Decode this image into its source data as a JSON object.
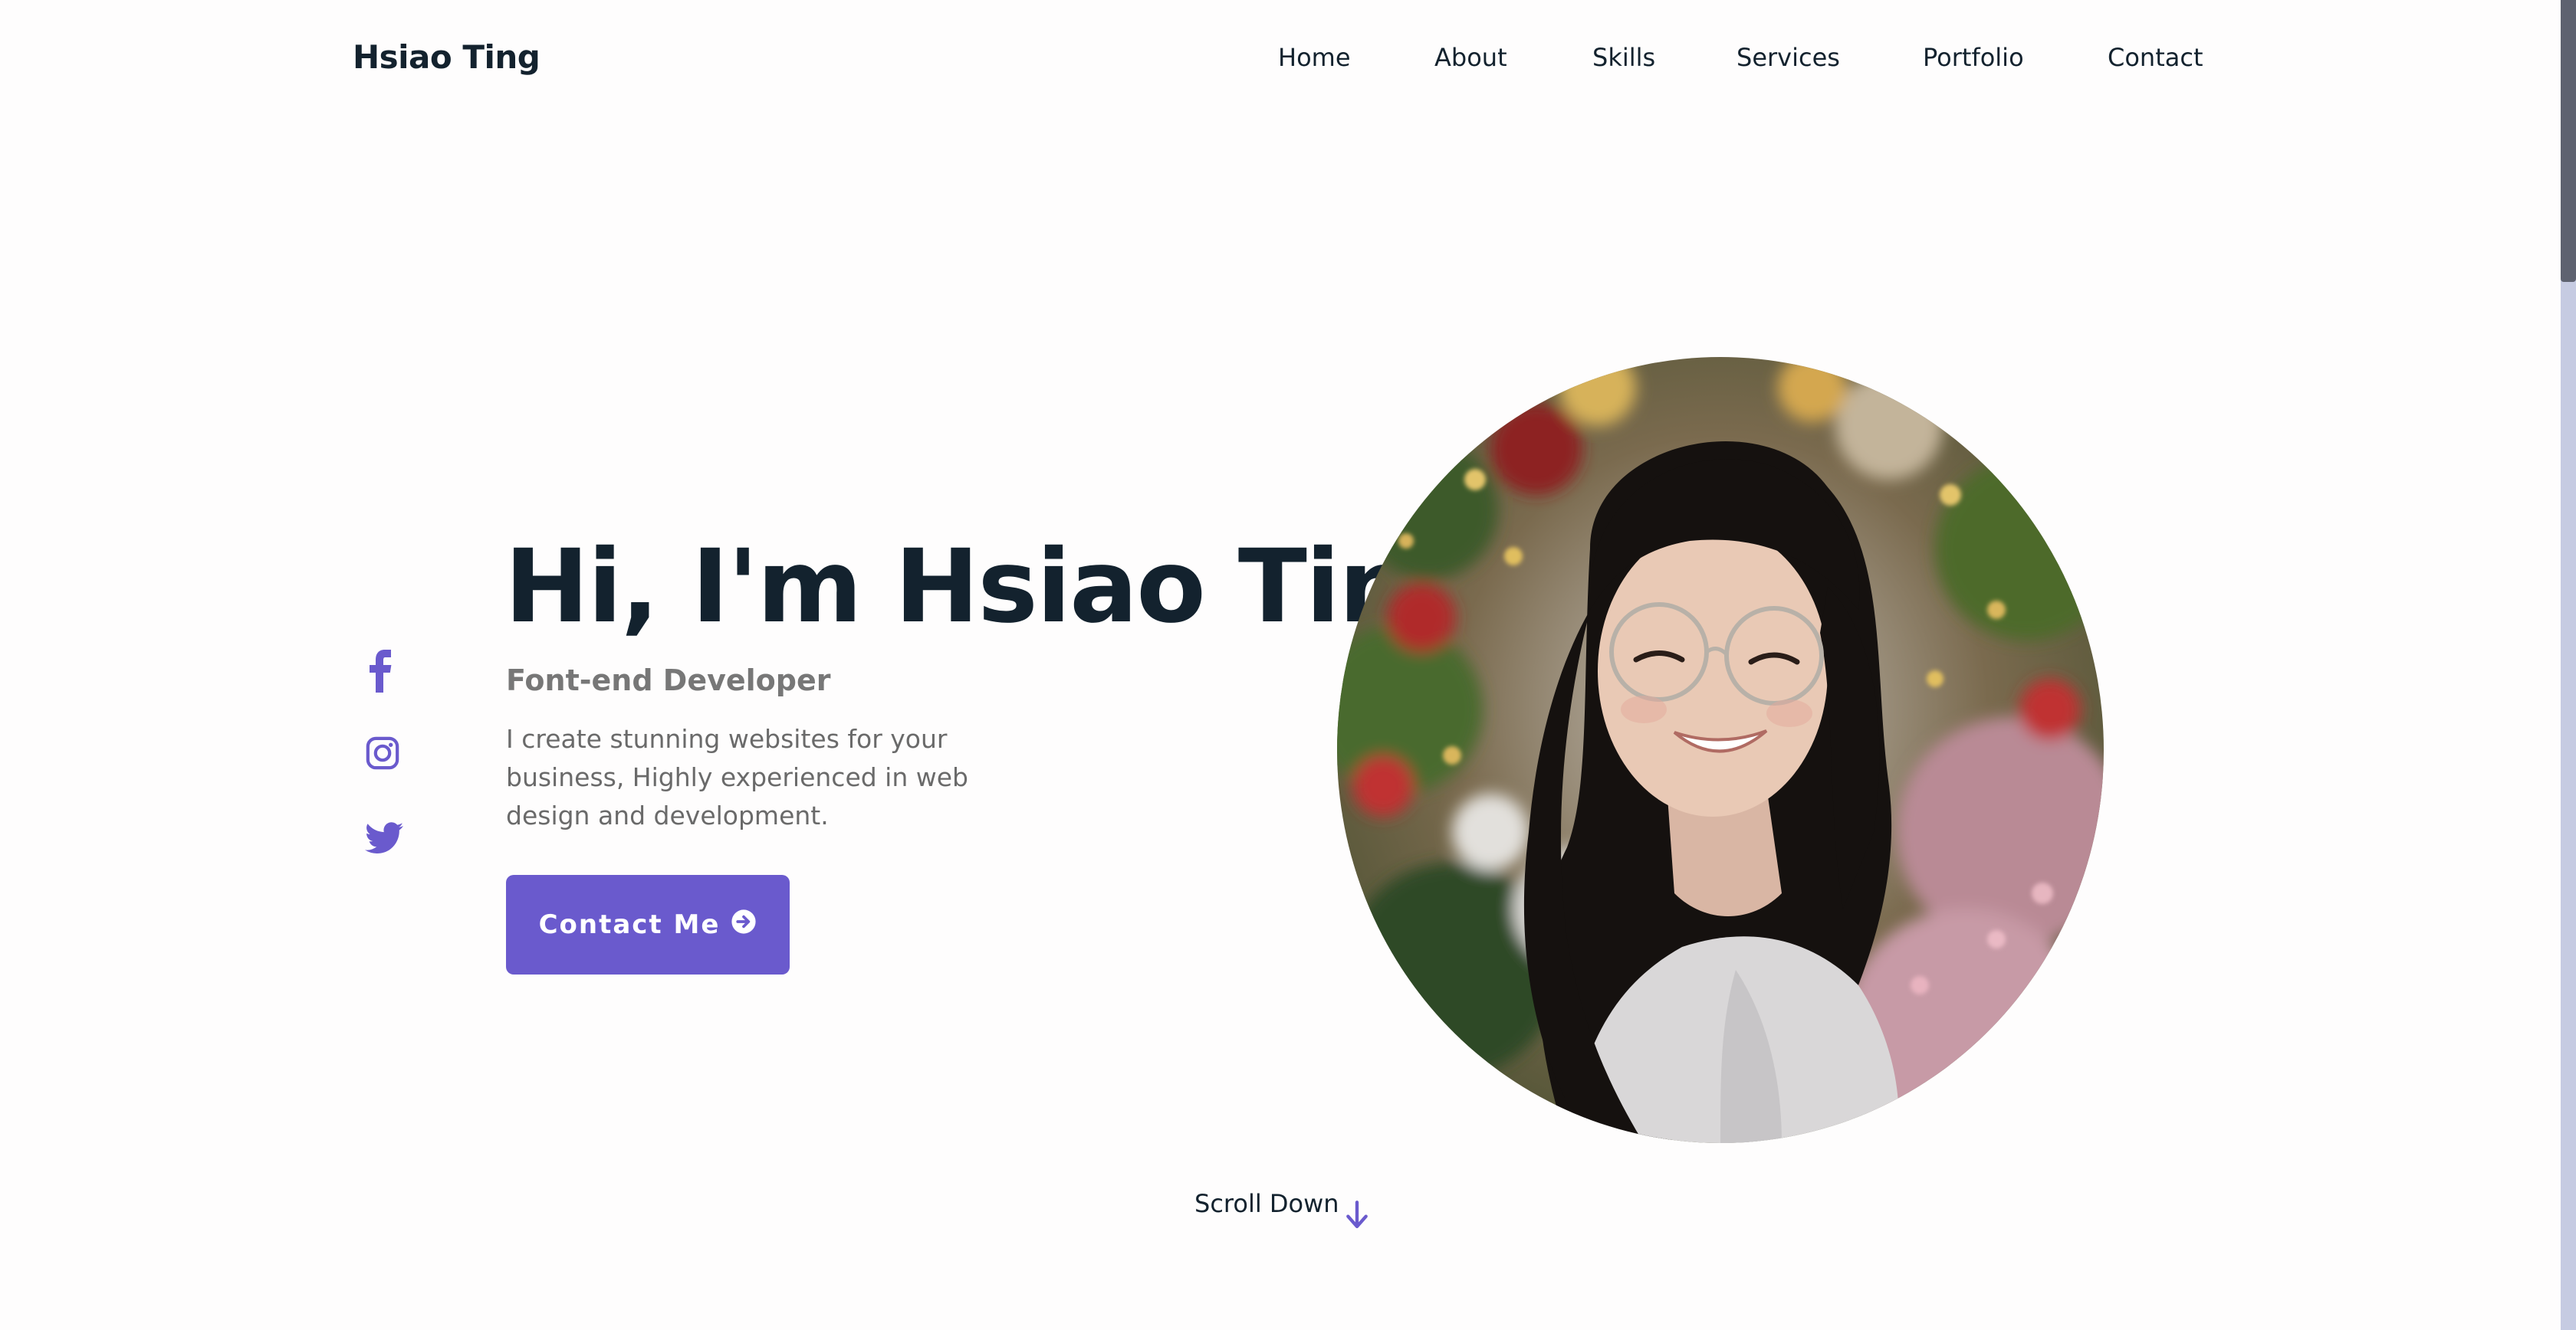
{
  "header": {
    "logo": "Hsiao Ting",
    "nav": [
      "Home",
      "About",
      "Skills",
      "Services",
      "Portfolio",
      "Contact"
    ]
  },
  "social": {
    "icons": [
      "facebook-icon",
      "instagram-icon",
      "twitter-icon"
    ]
  },
  "hero": {
    "title": "Hi, I'm Hsiao Ting",
    "subtitle": "Font-end Developer",
    "description": "I create stunning websites for your business, Highly experienced in web design and development.",
    "cta_label": "Contact Me",
    "cta_icon": "arrow-right-circle-icon",
    "photo_icon": "portrait-photo"
  },
  "scroll": {
    "label": "Scroll Down",
    "icon": "arrow-down-icon"
  },
  "colors": {
    "accent": "#6a5acd",
    "text_dark": "#13222e",
    "text_muted": "#777777",
    "background": "#fefdfd"
  }
}
